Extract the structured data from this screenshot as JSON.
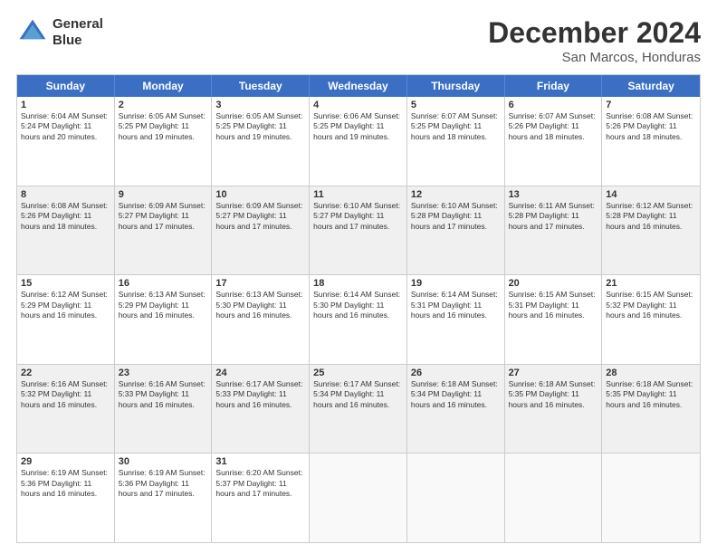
{
  "header": {
    "logo_line1": "General",
    "logo_line2": "Blue",
    "title": "December 2024",
    "location": "San Marcos, Honduras"
  },
  "days_of_week": [
    "Sunday",
    "Monday",
    "Tuesday",
    "Wednesday",
    "Thursday",
    "Friday",
    "Saturday"
  ],
  "weeks": [
    [
      {
        "day": "1",
        "text": "Sunrise: 6:04 AM\nSunset: 5:24 PM\nDaylight: 11 hours\nand 20 minutes.",
        "shaded": false
      },
      {
        "day": "2",
        "text": "Sunrise: 6:05 AM\nSunset: 5:25 PM\nDaylight: 11 hours\nand 19 minutes.",
        "shaded": false
      },
      {
        "day": "3",
        "text": "Sunrise: 6:05 AM\nSunset: 5:25 PM\nDaylight: 11 hours\nand 19 minutes.",
        "shaded": false
      },
      {
        "day": "4",
        "text": "Sunrise: 6:06 AM\nSunset: 5:25 PM\nDaylight: 11 hours\nand 19 minutes.",
        "shaded": false
      },
      {
        "day": "5",
        "text": "Sunrise: 6:07 AM\nSunset: 5:25 PM\nDaylight: 11 hours\nand 18 minutes.",
        "shaded": false
      },
      {
        "day": "6",
        "text": "Sunrise: 6:07 AM\nSunset: 5:26 PM\nDaylight: 11 hours\nand 18 minutes.",
        "shaded": false
      },
      {
        "day": "7",
        "text": "Sunrise: 6:08 AM\nSunset: 5:26 PM\nDaylight: 11 hours\nand 18 minutes.",
        "shaded": false
      }
    ],
    [
      {
        "day": "8",
        "text": "Sunrise: 6:08 AM\nSunset: 5:26 PM\nDaylight: 11 hours\nand 18 minutes.",
        "shaded": true
      },
      {
        "day": "9",
        "text": "Sunrise: 6:09 AM\nSunset: 5:27 PM\nDaylight: 11 hours\nand 17 minutes.",
        "shaded": true
      },
      {
        "day": "10",
        "text": "Sunrise: 6:09 AM\nSunset: 5:27 PM\nDaylight: 11 hours\nand 17 minutes.",
        "shaded": true
      },
      {
        "day": "11",
        "text": "Sunrise: 6:10 AM\nSunset: 5:27 PM\nDaylight: 11 hours\nand 17 minutes.",
        "shaded": true
      },
      {
        "day": "12",
        "text": "Sunrise: 6:10 AM\nSunset: 5:28 PM\nDaylight: 11 hours\nand 17 minutes.",
        "shaded": true
      },
      {
        "day": "13",
        "text": "Sunrise: 6:11 AM\nSunset: 5:28 PM\nDaylight: 11 hours\nand 17 minutes.",
        "shaded": true
      },
      {
        "day": "14",
        "text": "Sunrise: 6:12 AM\nSunset: 5:28 PM\nDaylight: 11 hours\nand 16 minutes.",
        "shaded": true
      }
    ],
    [
      {
        "day": "15",
        "text": "Sunrise: 6:12 AM\nSunset: 5:29 PM\nDaylight: 11 hours\nand 16 minutes.",
        "shaded": false
      },
      {
        "day": "16",
        "text": "Sunrise: 6:13 AM\nSunset: 5:29 PM\nDaylight: 11 hours\nand 16 minutes.",
        "shaded": false
      },
      {
        "day": "17",
        "text": "Sunrise: 6:13 AM\nSunset: 5:30 PM\nDaylight: 11 hours\nand 16 minutes.",
        "shaded": false
      },
      {
        "day": "18",
        "text": "Sunrise: 6:14 AM\nSunset: 5:30 PM\nDaylight: 11 hours\nand 16 minutes.",
        "shaded": false
      },
      {
        "day": "19",
        "text": "Sunrise: 6:14 AM\nSunset: 5:31 PM\nDaylight: 11 hours\nand 16 minutes.",
        "shaded": false
      },
      {
        "day": "20",
        "text": "Sunrise: 6:15 AM\nSunset: 5:31 PM\nDaylight: 11 hours\nand 16 minutes.",
        "shaded": false
      },
      {
        "day": "21",
        "text": "Sunrise: 6:15 AM\nSunset: 5:32 PM\nDaylight: 11 hours\nand 16 minutes.",
        "shaded": false
      }
    ],
    [
      {
        "day": "22",
        "text": "Sunrise: 6:16 AM\nSunset: 5:32 PM\nDaylight: 11 hours\nand 16 minutes.",
        "shaded": true
      },
      {
        "day": "23",
        "text": "Sunrise: 6:16 AM\nSunset: 5:33 PM\nDaylight: 11 hours\nand 16 minutes.",
        "shaded": true
      },
      {
        "day": "24",
        "text": "Sunrise: 6:17 AM\nSunset: 5:33 PM\nDaylight: 11 hours\nand 16 minutes.",
        "shaded": true
      },
      {
        "day": "25",
        "text": "Sunrise: 6:17 AM\nSunset: 5:34 PM\nDaylight: 11 hours\nand 16 minutes.",
        "shaded": true
      },
      {
        "day": "26",
        "text": "Sunrise: 6:18 AM\nSunset: 5:34 PM\nDaylight: 11 hours\nand 16 minutes.",
        "shaded": true
      },
      {
        "day": "27",
        "text": "Sunrise: 6:18 AM\nSunset: 5:35 PM\nDaylight: 11 hours\nand 16 minutes.",
        "shaded": true
      },
      {
        "day": "28",
        "text": "Sunrise: 6:18 AM\nSunset: 5:35 PM\nDaylight: 11 hours\nand 16 minutes.",
        "shaded": true
      }
    ],
    [
      {
        "day": "29",
        "text": "Sunrise: 6:19 AM\nSunset: 5:36 PM\nDaylight: 11 hours\nand 16 minutes.",
        "shaded": false
      },
      {
        "day": "30",
        "text": "Sunrise: 6:19 AM\nSunset: 5:36 PM\nDaylight: 11 hours\nand 17 minutes.",
        "shaded": false
      },
      {
        "day": "31",
        "text": "Sunrise: 6:20 AM\nSunset: 5:37 PM\nDaylight: 11 hours\nand 17 minutes.",
        "shaded": false
      },
      {
        "day": "",
        "text": "",
        "shaded": false,
        "empty": true
      },
      {
        "day": "",
        "text": "",
        "shaded": false,
        "empty": true
      },
      {
        "day": "",
        "text": "",
        "shaded": false,
        "empty": true
      },
      {
        "day": "",
        "text": "",
        "shaded": false,
        "empty": true
      }
    ]
  ]
}
